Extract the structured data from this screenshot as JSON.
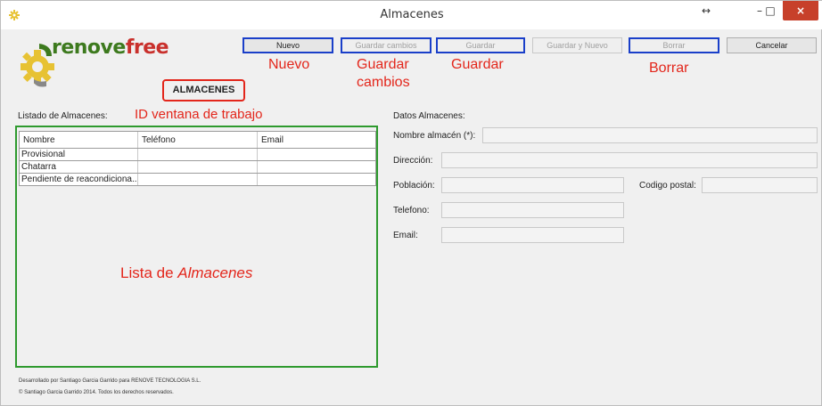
{
  "window": {
    "title": "Almacenes",
    "resize_glyph": "↔",
    "minimize_glyph": "–",
    "maximize_glyph": "□",
    "close_glyph": "×"
  },
  "logo": {
    "part1": "renove",
    "part2": "free"
  },
  "toolbar": {
    "nuevo": "Nuevo",
    "guardar_cambios": "Guardar cambios",
    "guardar": "Guardar",
    "guardar_y_nuevo": "Guardar y Nuevo",
    "borrar": "Borrar",
    "cancelar": "Cancelar"
  },
  "annotations": {
    "nuevo": "Nuevo",
    "guardar_cambios_1": "Guardar",
    "guardar_cambios_2": "cambios",
    "guardar": "Guardar",
    "borrar": "Borrar",
    "id_ventana": "ID ventana de trabajo",
    "lista_prefix": "Lista de ",
    "lista_italic": "Almacenes"
  },
  "window_id": "ALMACENES",
  "list": {
    "label": "Listado de Almacenes:",
    "columns": [
      "Nombre",
      "Teléfono",
      "Email"
    ],
    "rows": [
      [
        "Provisional",
        "",
        ""
      ],
      [
        "Chatarra",
        "",
        ""
      ],
      [
        "Pendiente de reacondiciona...",
        "",
        ""
      ]
    ]
  },
  "form": {
    "section_label": "Datos Almacenes:",
    "nombre": "Nombre almacén (*):",
    "direccion": "Dirección:",
    "poblacion": "Población:",
    "codigo_postal": "Codigo postal:",
    "telefono": "Telefono:",
    "email": "Email:"
  },
  "footer": {
    "line1": "Desarrollado por Santiago Garcia Garrido para RENOVE TECNOLOGIA S.L.",
    "line2": "© Santiago Garcia Garrido 2014. Todos los derechos reservados."
  },
  "colors": {
    "annotation": "#e3261b",
    "button_highlight": "#1a3fc9",
    "list_highlight": "#2e9a2e",
    "close_button": "#c7402a"
  }
}
